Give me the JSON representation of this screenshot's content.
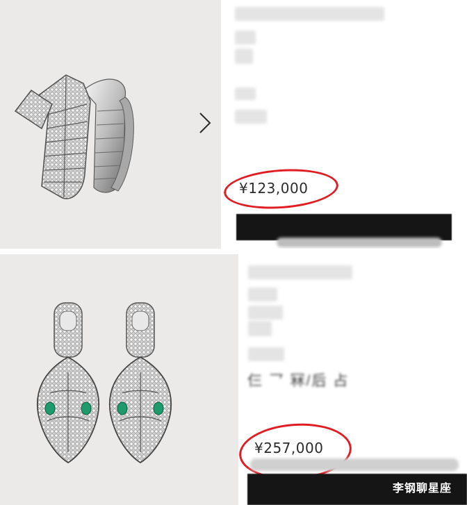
{
  "products": [
    {
      "image_icon": "serpenti-ring-icon",
      "next_icon": "chevron-right-icon",
      "price": "¥123,000"
    },
    {
      "image_icon": "serpenti-earrings-icon",
      "partial_text": "仨 乛 冧/后 占",
      "price": "¥257,000"
    }
  ],
  "watermark": "李钢聊星座",
  "colors": {
    "highlight": "#e01d23",
    "image_bg": "#eceae8",
    "bar": "#151515"
  }
}
